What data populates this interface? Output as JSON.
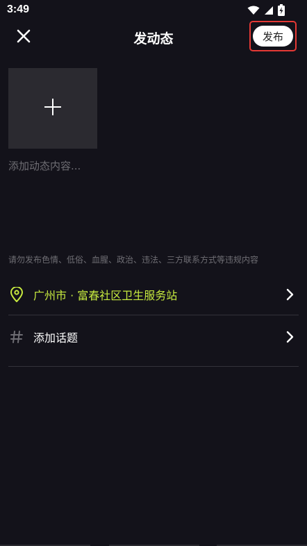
{
  "status_bar": {
    "time": "3:49",
    "icons": [
      "wifi-icon",
      "signal-icon",
      "battery-charging-icon"
    ]
  },
  "header": {
    "title": "发动态",
    "close_icon": "close-icon",
    "publish_label": "发布"
  },
  "media": {
    "add_icon": "plus-icon"
  },
  "content": {
    "placeholder": "添加动态内容...",
    "value": ""
  },
  "warning_text": "请勿发布色情、低俗、血腥、政治、违法、三方联系方式等违规内容",
  "location": {
    "icon": "location-pin-icon",
    "text": "广州市 · 富春社区卫生服务站"
  },
  "topic": {
    "icon": "hashtag-icon",
    "text": "添加话题"
  },
  "colors": {
    "background": "#13121a",
    "accent": "#c7ea3f",
    "highlight_border": "#e53935",
    "muted_text": "#6e6d73",
    "tile": "#2b2a30"
  }
}
